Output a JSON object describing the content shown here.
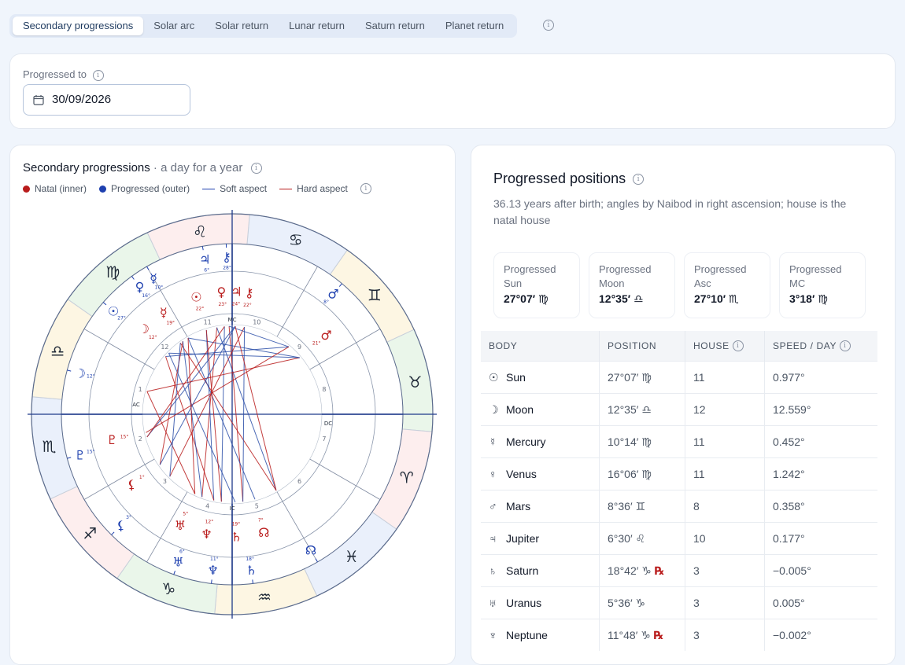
{
  "tabs": [
    {
      "label": "Secondary progressions",
      "active": true
    },
    {
      "label": "Solar arc"
    },
    {
      "label": "Solar return"
    },
    {
      "label": "Lunar return"
    },
    {
      "label": "Saturn return"
    },
    {
      "label": "Planet return"
    }
  ],
  "progressed_to": {
    "label": "Progressed to",
    "value": "30/09/2026"
  },
  "chart_card": {
    "title": "Secondary progressions",
    "subtitle": " · a day for a year",
    "legend": {
      "natal": "Natal (inner)",
      "progressed": "Progressed (outer)",
      "soft": "Soft aspect",
      "hard": "Hard aspect"
    },
    "colors": {
      "natal": "#b91c1c",
      "progressed": "#1e40af",
      "soft": "#2b4fa8",
      "hard": "#b91c1c"
    },
    "zodiac_glyphs": [
      "♋",
      "♊",
      "♉",
      "♈",
      "♓",
      "♒",
      "♑",
      "♐",
      "♏",
      "♎",
      "♍",
      "♌"
    ],
    "house_numbers": [
      "10",
      "9",
      "8",
      "7",
      "6",
      "5",
      "4",
      "3",
      "2",
      "1",
      "12",
      "11"
    ],
    "angle_labels": {
      "mc": "MC",
      "dc": "DC",
      "ic": "IC",
      "ac": "AC"
    },
    "planets_outer": [
      {
        "g": "♃",
        "deg": "6°"
      },
      {
        "g": "⚷",
        "deg": "28°"
      },
      {
        "g": "☿",
        "deg": "10°"
      },
      {
        "g": "♀",
        "deg": "16°"
      },
      {
        "g": "☉",
        "deg": "27°"
      },
      {
        "g": "☽",
        "deg": "12°"
      },
      {
        "g": "♂",
        "deg": "8°"
      },
      {
        "g": "♇",
        "deg": "15°"
      },
      {
        "g": "⚸",
        "deg": "3°"
      },
      {
        "g": "♅",
        "deg": "6°"
      },
      {
        "g": "♆",
        "deg": "11°"
      },
      {
        "g": "♄",
        "deg": "18°"
      },
      {
        "g": "☊",
        "deg": ""
      }
    ],
    "planets_inner": [
      {
        "g": "♀",
        "deg": "23°"
      },
      {
        "g": "♃",
        "deg": "24°"
      },
      {
        "g": "⚷",
        "deg": "22°"
      },
      {
        "g": "☉",
        "deg": "22°"
      },
      {
        "g": "☿",
        "deg": "19°"
      },
      {
        "g": "☽",
        "deg": "12°"
      },
      {
        "g": "♂",
        "deg": "21°"
      },
      {
        "g": "♇",
        "deg": "15°"
      },
      {
        "g": "⚸",
        "deg": "1°"
      },
      {
        "g": "♅",
        "deg": "5°"
      },
      {
        "g": "♆",
        "deg": "12°"
      },
      {
        "g": "♄",
        "deg": "19°"
      },
      {
        "g": "☊",
        "deg": "7°"
      }
    ]
  },
  "positions": {
    "title": "Progressed positions",
    "description": "36.13 years after birth; angles by Naibod in right ascension; house is the natal house",
    "angles": [
      {
        "label": "Progressed Sun",
        "value": "27°07′ ♍"
      },
      {
        "label": "Progressed Moon",
        "value": "12°35′ ♎"
      },
      {
        "label": "Progressed Asc",
        "value": "27°10′ ♏"
      },
      {
        "label": "Progressed MC",
        "value": "3°18′ ♍"
      }
    ],
    "columns": {
      "body": "BODY",
      "position": "POSITION",
      "house": "HOUSE",
      "speed": "SPEED / DAY"
    },
    "rows": [
      {
        "glyph": "☉",
        "name": "Sun",
        "position": "27°07′ ♍",
        "retro": "",
        "house": "11",
        "speed": "0.977°"
      },
      {
        "glyph": "☽",
        "name": "Moon",
        "position": "12°35′ ♎",
        "retro": "",
        "house": "12",
        "speed": "12.559°"
      },
      {
        "glyph": "☿",
        "name": "Mercury",
        "position": "10°14′ ♍",
        "retro": "",
        "house": "11",
        "speed": "0.452°"
      },
      {
        "glyph": "♀",
        "name": "Venus",
        "position": "16°06′ ♍",
        "retro": "",
        "house": "11",
        "speed": "1.242°"
      },
      {
        "glyph": "♂",
        "name": "Mars",
        "position": "8°36′ ♊",
        "retro": "",
        "house": "8",
        "speed": "0.358°"
      },
      {
        "glyph": "♃",
        "name": "Jupiter",
        "position": "6°30′ ♌",
        "retro": "",
        "house": "10",
        "speed": "0.177°"
      },
      {
        "glyph": "♄",
        "name": "Saturn",
        "position": "18°42′ ♑",
        "retro": "℞",
        "house": "3",
        "speed": "−0.005°"
      },
      {
        "glyph": "♅",
        "name": "Uranus",
        "position": "5°36′ ♑",
        "retro": "",
        "house": "3",
        "speed": "0.005°"
      },
      {
        "glyph": "♆",
        "name": "Neptune",
        "position": "11°48′ ♑",
        "retro": "℞",
        "house": "3",
        "speed": "−0.002°"
      }
    ]
  }
}
